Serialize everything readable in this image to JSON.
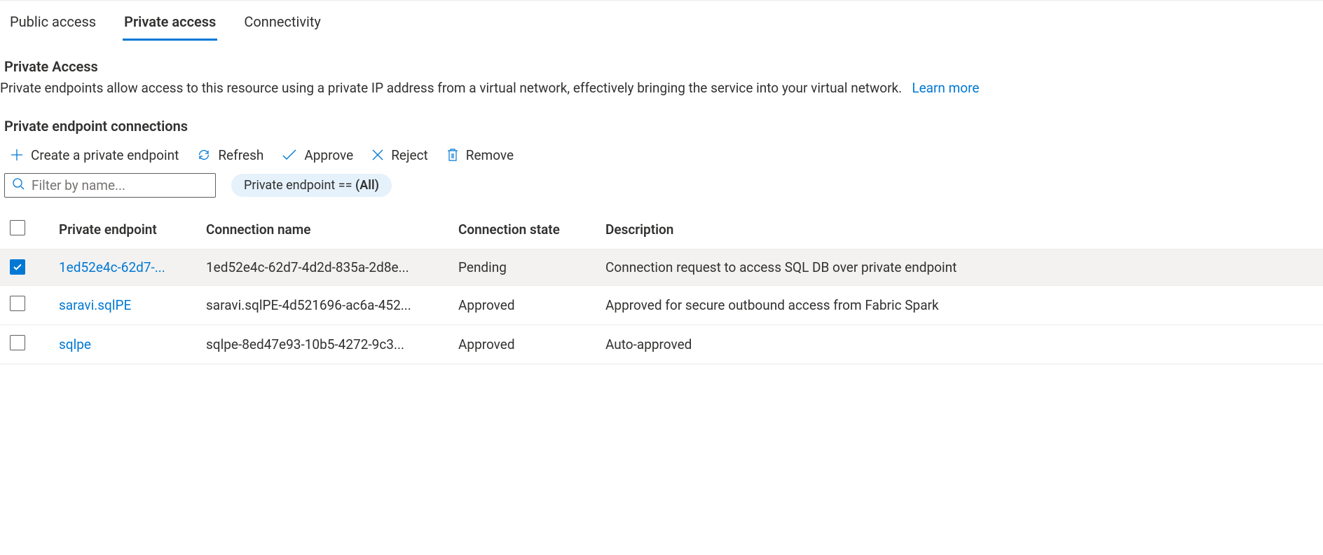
{
  "tabs": [
    {
      "label": "Public access",
      "active": false
    },
    {
      "label": "Private access",
      "active": true
    },
    {
      "label": "Connectivity",
      "active": false
    }
  ],
  "section": {
    "title": "Private Access",
    "description": "Private endpoints allow access to this resource using a private IP address from a virtual network, effectively bringing the service into your virtual network.",
    "learn_more": "Learn more"
  },
  "connections_title": "Private endpoint connections",
  "toolbar": {
    "create": "Create a private endpoint",
    "refresh": "Refresh",
    "approve": "Approve",
    "reject": "Reject",
    "remove": "Remove"
  },
  "filter": {
    "placeholder": "Filter by name...",
    "pill_prefix": "Private endpoint == ",
    "pill_value": "(All)"
  },
  "table": {
    "headers": {
      "pe": "Private endpoint",
      "conn": "Connection name",
      "state": "Connection state",
      "desc": "Description"
    },
    "rows": [
      {
        "checked": true,
        "pe": "1ed52e4c-62d7-...",
        "conn": "1ed52e4c-62d7-4d2d-835a-2d8e...",
        "state": "Pending",
        "desc": "Connection request to access SQL DB over private endpoint"
      },
      {
        "checked": false,
        "pe": "saravi.sqlPE",
        "conn": "saravi.sqlPE-4d521696-ac6a-452...",
        "state": "Approved",
        "desc": "Approved for secure outbound access from Fabric Spark"
      },
      {
        "checked": false,
        "pe": "sqlpe",
        "conn": "sqlpe-8ed47e93-10b5-4272-9c3...",
        "state": "Approved",
        "desc": "Auto-approved"
      }
    ]
  }
}
